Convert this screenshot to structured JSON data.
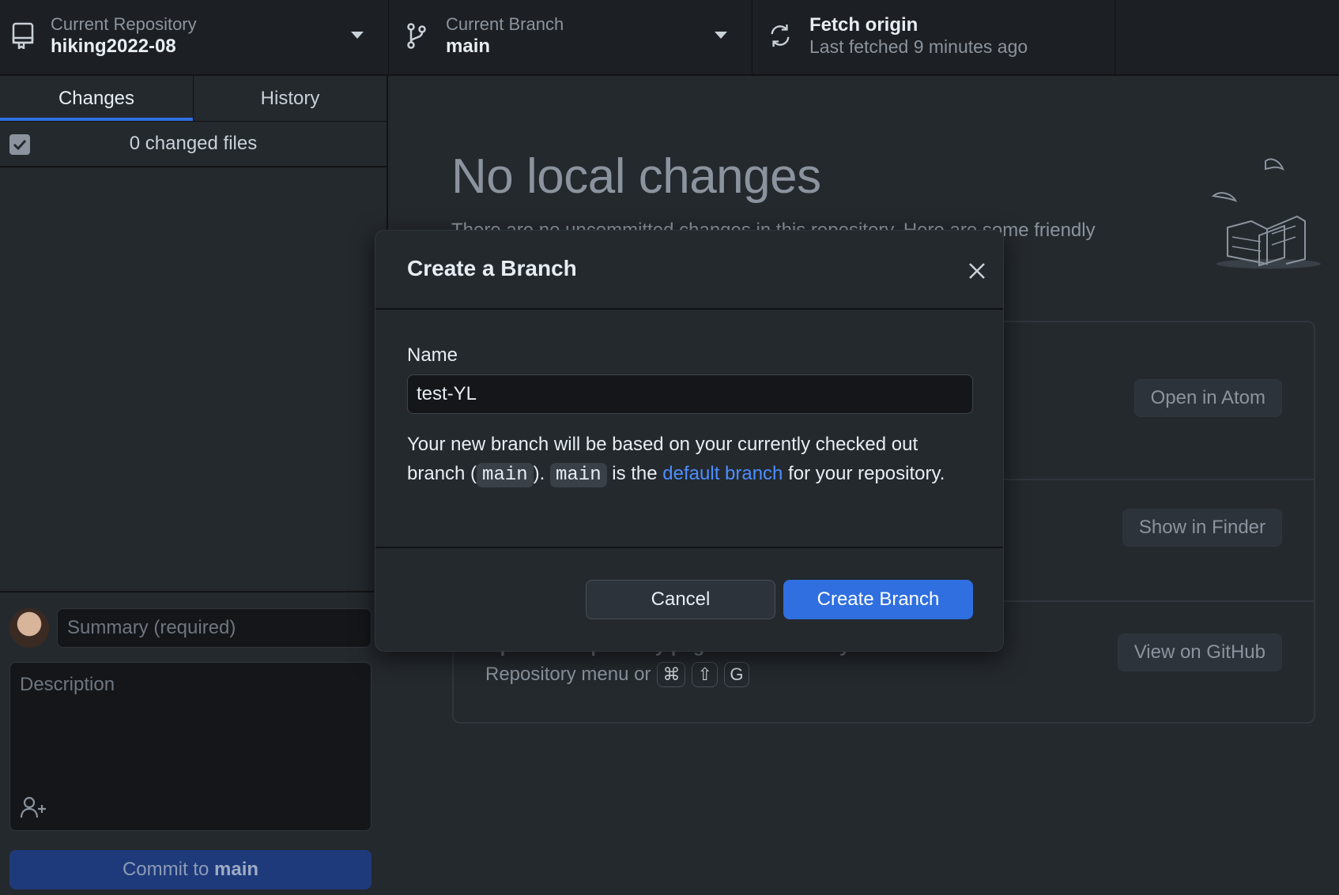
{
  "toolbar": {
    "repo": {
      "label": "Current Repository",
      "value": "hiking2022-08",
      "icon": "repo-icon"
    },
    "branch": {
      "label": "Current Branch",
      "value": "main",
      "icon": "git-branch-icon"
    },
    "fetch": {
      "label": "Fetch origin",
      "subtitle": "Last fetched 9 minutes ago",
      "icon": "sync-icon"
    }
  },
  "sidebar": {
    "tabs": [
      {
        "label": "Changes",
        "active": true
      },
      {
        "label": "History",
        "active": false
      }
    ],
    "changed_files": "0 changed files",
    "summary_placeholder": "Summary (required)",
    "description_placeholder": "Description",
    "commit_prefix": "Commit to",
    "commit_branch": "main"
  },
  "main": {
    "heading": "No local changes",
    "subtext": "There are no uncommitted changes in this repository. Here are some friendly",
    "actions": [
      {
        "button": "Open in Atom"
      },
      {
        "button": "Show in Finder"
      },
      {
        "title": "Open the repository page on GitHub in your browser",
        "desc_prefix": "Repository menu or",
        "keys": [
          "⌘",
          "⇧",
          "G"
        ],
        "button": "View on GitHub"
      }
    ]
  },
  "dialog": {
    "title": "Create a Branch",
    "name_label": "Name",
    "name_value": "test-YL",
    "text": {
      "part1": "Your new branch will be based on your currently checked out branch (",
      "code1": "main",
      "part2": "). ",
      "code2": "main",
      "part3": " is the ",
      "link": "default branch",
      "part4": " for your repository."
    },
    "cancel_label": "Cancel",
    "create_label": "Create Branch"
  },
  "colors": {
    "accent": "#2f6fe0",
    "link": "#4c8eff",
    "background": "#24292e",
    "toolbar": "#1c1f23"
  }
}
